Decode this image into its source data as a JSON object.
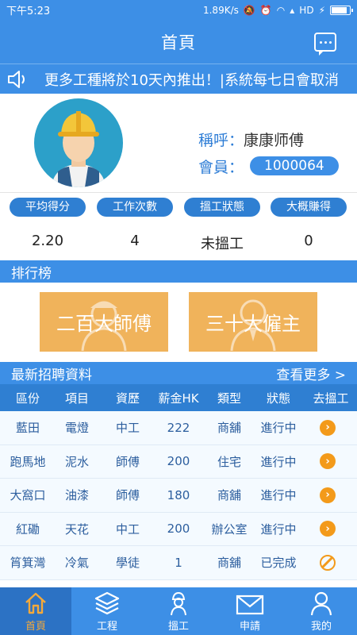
{
  "status_bar": {
    "time": "下午5:23",
    "speed": "1.89K/s",
    "network": "HD",
    "battery_level": 0.9
  },
  "header": {
    "title": "首頁",
    "message_icon": "chat-bubble-icon"
  },
  "announcement": {
    "text": "更多工種將於10天內推出！|系統每七日會取消"
  },
  "profile": {
    "name_label": "稱呼：",
    "name": "康康师傅",
    "member_label": "會員：",
    "member_id": "1000064"
  },
  "stats": [
    {
      "label": "平均得分",
      "value": "2.20"
    },
    {
      "label": "工作次數",
      "value": "4"
    },
    {
      "label": "搵工狀態",
      "value": "未搵工"
    },
    {
      "label": "大概賺得",
      "value": "0"
    }
  ],
  "ranking": {
    "title": "排行榜",
    "buttons": [
      {
        "label": "二百大師傅"
      },
      {
        "label": "三十大僱主"
      }
    ]
  },
  "jobs": {
    "title": "最新招聘資料",
    "more_link": "查看更多 >",
    "columns": [
      "區份",
      "項目",
      "資歷",
      "薪金HK",
      "類型",
      "狀態",
      "去搵工"
    ],
    "rows": [
      {
        "district": "藍田",
        "item": "電燈",
        "level": "中工",
        "salary": "222",
        "type": "商舖",
        "status": "進行中",
        "action": "go"
      },
      {
        "district": "跑馬地",
        "item": "泥水",
        "level": "師傅",
        "salary": "200",
        "type": "住宅",
        "status": "進行中",
        "action": "go"
      },
      {
        "district": "大窩口",
        "item": "油漆",
        "level": "師傅",
        "salary": "180",
        "type": "商舖",
        "status": "進行中",
        "action": "go"
      },
      {
        "district": "紅磡",
        "item": "天花",
        "level": "中工",
        "salary": "200",
        "type": "辦公室",
        "status": "進行中",
        "action": "go"
      },
      {
        "district": "筲箕灣",
        "item": "冷氣",
        "level": "學徒",
        "salary": "1",
        "type": "商舖",
        "status": "已完成",
        "action": "done"
      }
    ]
  },
  "tabbar": [
    {
      "label": "首頁",
      "icon": "home-icon",
      "active": true
    },
    {
      "label": "工程",
      "icon": "layers-icon",
      "active": false
    },
    {
      "label": "搵工",
      "icon": "worker-icon",
      "active": false
    },
    {
      "label": "申請",
      "icon": "mail-icon",
      "active": false
    },
    {
      "label": "我的",
      "icon": "person-icon",
      "active": false
    }
  ],
  "colors": {
    "primary": "#3d8fe6",
    "pill": "#2f7fd2",
    "accent": "#f39a1a",
    "rank_button": "#f0b35b"
  }
}
